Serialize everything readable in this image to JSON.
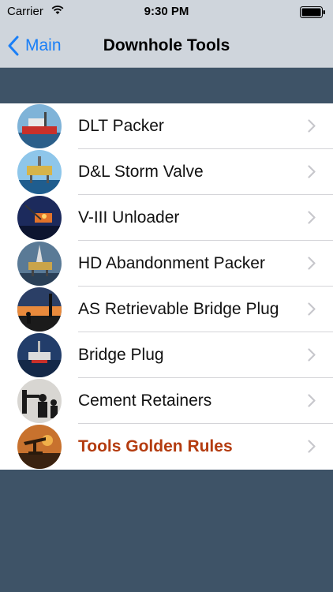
{
  "status": {
    "carrier": "Carrier",
    "time": "9:30 PM"
  },
  "nav": {
    "back_label": "Main",
    "title": "Downhole Tools"
  },
  "rows": [
    {
      "label": "DLT Packer",
      "image": "ship-photo"
    },
    {
      "label": "D&L Storm Valve",
      "image": "offshore-platform-photo"
    },
    {
      "label": "V-III Unloader",
      "image": "platform-night-photo"
    },
    {
      "label": "HD Abandonment Packer",
      "image": "drilling-rig-photo"
    },
    {
      "label": "AS Retrievable Bridge Plug",
      "image": "workers-sunset-photo"
    },
    {
      "label": "Bridge Plug",
      "image": "rig-at-sea-photo"
    },
    {
      "label": "Cement Retainers",
      "image": "workers-silhouette-photo"
    },
    {
      "label": "Tools Golden Rules",
      "image": "pumpjack-sunset-photo"
    }
  ],
  "colors": {
    "accent": "#1a7ff7",
    "highlight_text": "#b43c10",
    "background": "#3e5367"
  }
}
